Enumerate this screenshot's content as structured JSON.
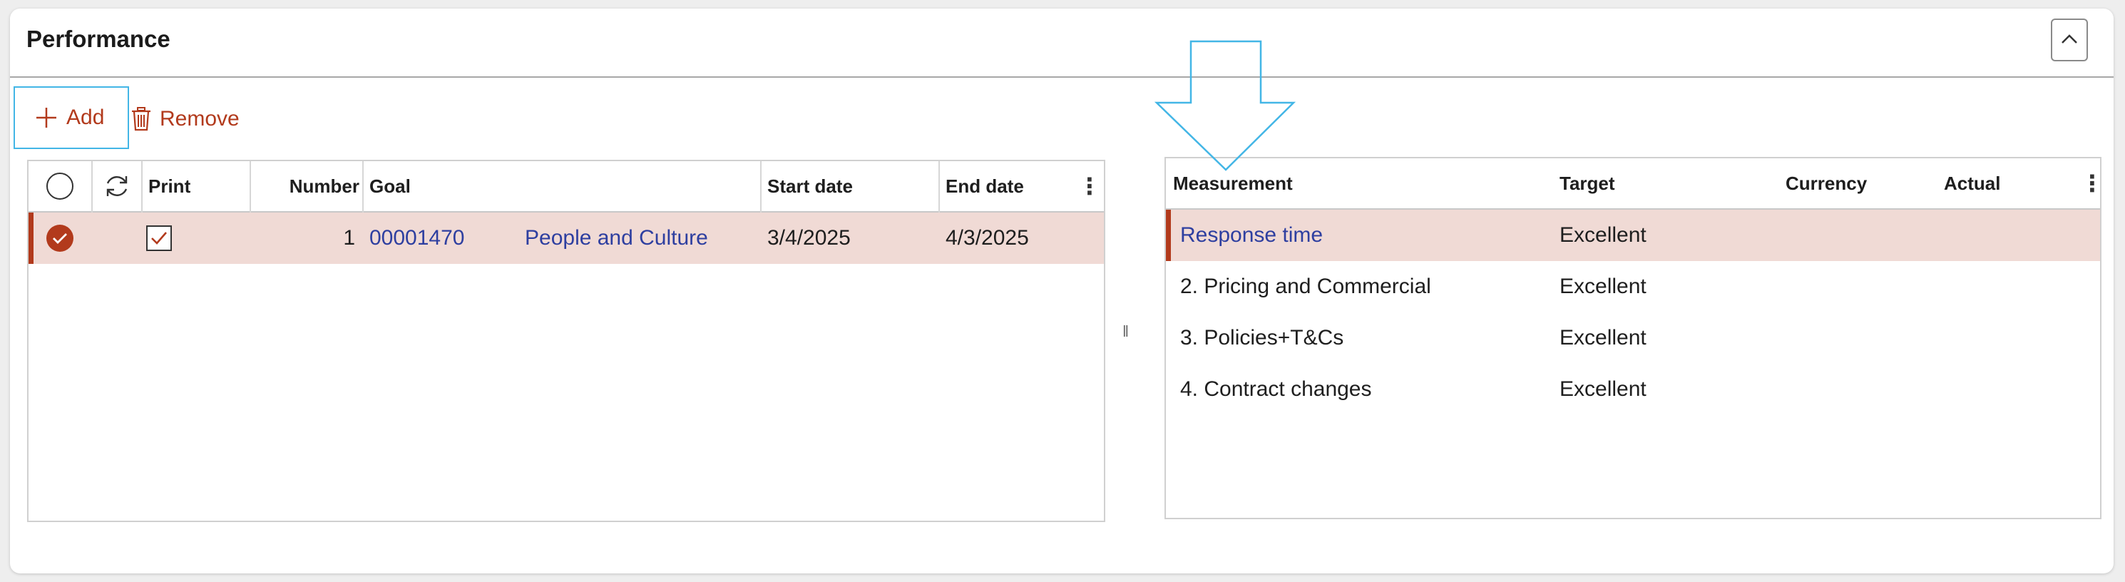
{
  "section": {
    "title": "Performance",
    "collapse_icon": "chevron-up-icon"
  },
  "toolbar": {
    "add_label": "Add",
    "remove_label": "Remove"
  },
  "goals_grid": {
    "columns": [
      "Print",
      "Number",
      "Goal",
      "Start date",
      "End date"
    ],
    "rows": [
      {
        "selected": true,
        "print_checked": true,
        "number": "1",
        "goal_id": "00001470",
        "goal_name": "People and Culture",
        "start_date": "3/4/2025",
        "end_date": "4/3/2025"
      }
    ]
  },
  "measurements_grid": {
    "columns": [
      "Measurement",
      "Target",
      "Currency",
      "Actual"
    ],
    "rows": [
      {
        "measurement": "Response time",
        "target": "Excellent",
        "selected": true
      },
      {
        "measurement": "2. Pricing and Commercial",
        "target": "Excellent",
        "selected": false
      },
      {
        "measurement": "3. Policies+T&Cs",
        "target": "Excellent",
        "selected": false
      },
      {
        "measurement": "4. Contract changes",
        "target": "Excellent",
        "selected": false
      }
    ]
  },
  "colors": {
    "accent": "#b23a1c",
    "selected_row": "#f0dad5",
    "link": "#2e3fa0",
    "annotation": "#43b6e6"
  }
}
